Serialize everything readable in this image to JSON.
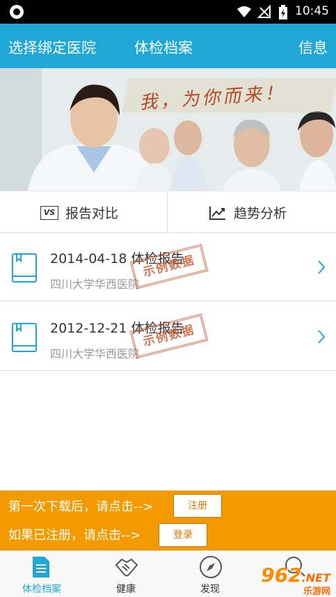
{
  "status_bar": {
    "time": "10:45"
  },
  "header": {
    "left": "选择绑定医院",
    "center": "体检档案",
    "right": "信息"
  },
  "banner": {
    "slogan": "我，为你而来！"
  },
  "tabs": [
    {
      "label": "报告对比",
      "icon": "vs-icon"
    },
    {
      "label": "趋势分析",
      "icon": "trend-chart-icon"
    }
  ],
  "reports": [
    {
      "date_title": "2014-04-18 体检报告",
      "hospital": "四川大学华西医院",
      "stamp": "示例数据"
    },
    {
      "date_title": "2012-12-21 体检报告",
      "hospital": "四川大学华西医院",
      "stamp": "示例数据"
    }
  ],
  "prompt": {
    "line1": "第一次下载后，请点击-->",
    "register_label": "注册",
    "line2": "如果已注册，请点击-->",
    "login_label": "登录"
  },
  "nav": [
    {
      "label": "体检档案",
      "icon": "document-icon",
      "active": true
    },
    {
      "label": "健康",
      "icon": "handshake-icon",
      "active": false
    },
    {
      "label": "发现",
      "icon": "compass-icon",
      "active": false
    },
    {
      "label": "",
      "icon": "search-icon",
      "active": false
    }
  ],
  "watermark": {
    "main": "962",
    "sub": ".NET",
    "tag": "乐游网"
  },
  "colors": {
    "accent": "#1fa8d6",
    "orange": "#f39a00"
  }
}
